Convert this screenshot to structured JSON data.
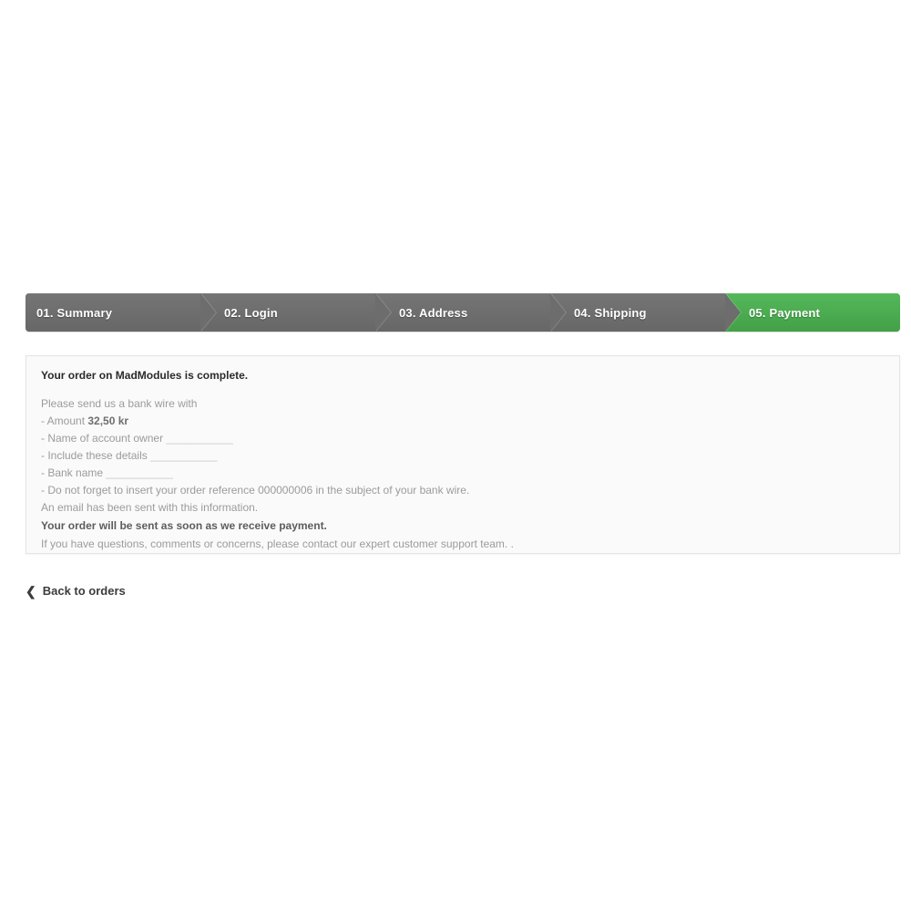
{
  "steps": {
    "items": [
      {
        "label": "01. Summary",
        "state": "pending"
      },
      {
        "label": "02. Login",
        "state": "pending"
      },
      {
        "label": "03. Address",
        "state": "pending"
      },
      {
        "label": "04. Shipping",
        "state": "pending"
      },
      {
        "label": "05. Payment",
        "state": "current"
      }
    ],
    "colors": {
      "pending": "#6d6d6d",
      "current": "#4caf50",
      "label": "#ffffff"
    }
  },
  "order_confirmation": {
    "title": "Your order on MadModules is complete.",
    "intro": "Please send us a bank wire with",
    "amount_label": "- Amount ",
    "amount_value": "32,50 kr",
    "account_owner_label": "- Name of account owner ",
    "account_owner_blank": "___________",
    "details_label": "- Include these details ",
    "details_blank": "___________",
    "bank_name_label": "- Bank name ",
    "bank_name_blank": "___________",
    "reference_line": "- Do not forget to insert your order reference 000000006 in the subject of your bank wire.",
    "order_reference": "000000006",
    "email_notice": "An email has been sent with this information.",
    "shipping_notice": "Your order will be sent as soon as we receive payment.",
    "support_notice": "If you have questions, comments or concerns, please contact our expert customer support team. ."
  },
  "footer": {
    "back_icon": "❮",
    "back_label": "Back to orders"
  }
}
